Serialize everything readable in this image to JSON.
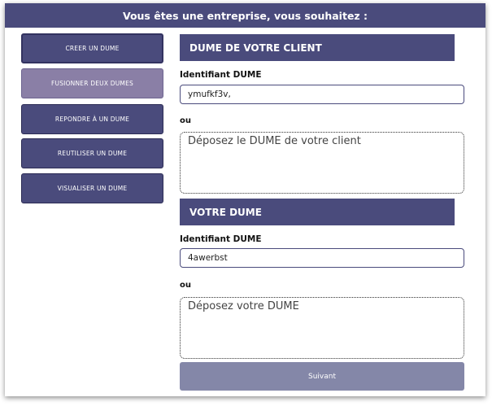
{
  "banner": {
    "prefix": "Vous êtes une ",
    "emphasis": "entreprise",
    "suffix": ", vous souhaitez :"
  },
  "sidebar": {
    "items": [
      {
        "label": "CREER UN DUME"
      },
      {
        "label": "FUSIONNER DEUX DUMES"
      },
      {
        "label": "REPONDRE À UN DUME"
      },
      {
        "label": "REUTILISER UN DUME"
      },
      {
        "label": "VISUALISER UN DUME"
      }
    ],
    "active_index": 1
  },
  "client_section": {
    "title": "DUME DE VOTRE CLIENT",
    "id_label": "Identifiant DUME",
    "id_value": "ymufkf3v,",
    "or_label": "ou",
    "drop_label": "Déposez le DUME de votre client"
  },
  "own_section": {
    "title": "VOTRE DUME",
    "id_label": "Identifiant DUME",
    "id_value": "4awerbst",
    "or_label": "ou",
    "drop_label": "Déposez votre DUME"
  },
  "actions": {
    "next_label": "Suivant"
  },
  "colors": {
    "primary": "#4a4b7c",
    "active_item": "#8a7fa6",
    "next_button": "#8487a8"
  }
}
